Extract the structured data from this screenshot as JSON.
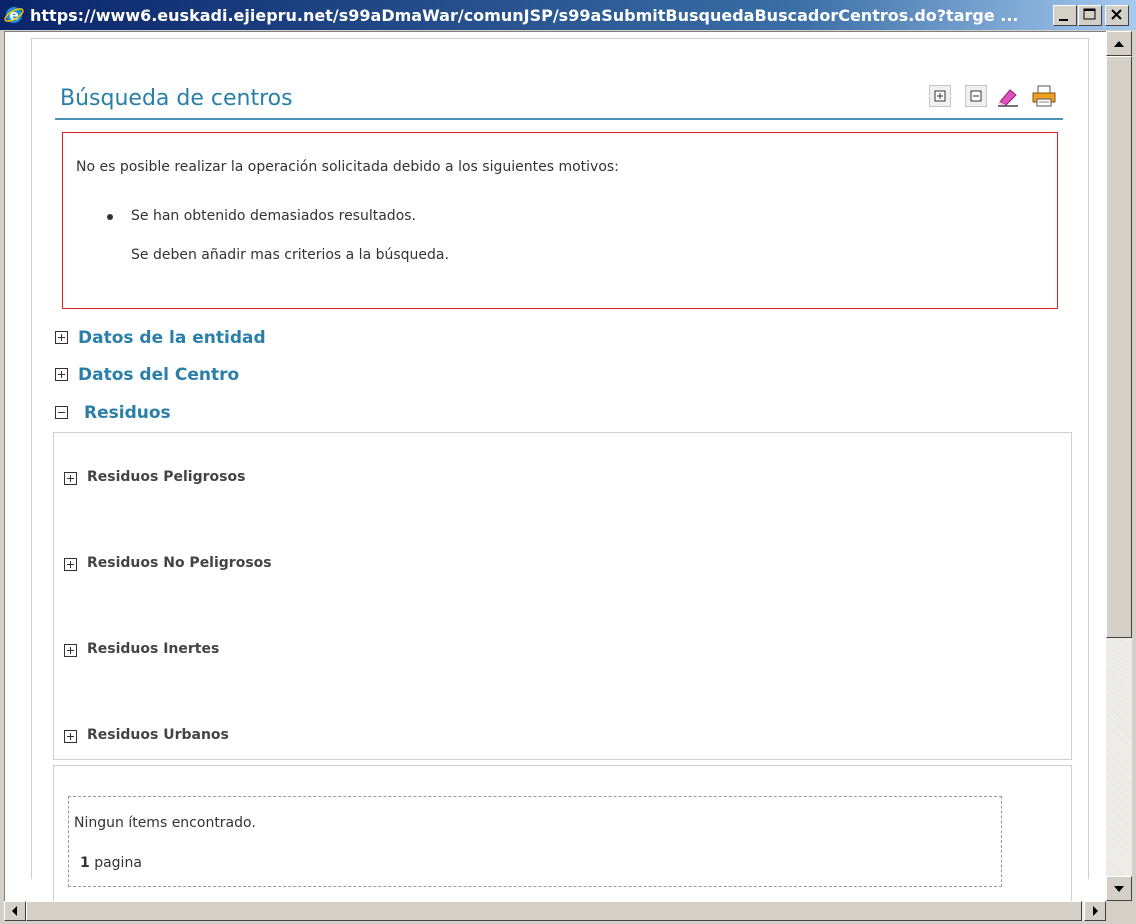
{
  "window": {
    "title": "https://www6.euskadi.ejiepru.net/s99aDmaWar/comunJSP/s99aSubmitBusquedaBuscadorCentros.do?targe ..."
  },
  "page": {
    "title": "Búsqueda de centros",
    "toolbar": [
      "expand-all-icon",
      "collapse-all-icon",
      "clear-form-icon",
      "print-icon"
    ]
  },
  "error": {
    "intro": "No es posible realizar la operación solicitada debido a los siguientes motivos:",
    "reason": "Se han obtenido demasiados resultados.",
    "hint": "Se deben añadir mas criterios a la búsqueda.",
    "border_color": "#e02020"
  },
  "sections": {
    "entidad": "Datos de la entidad",
    "centro": "Datos del Centro",
    "residuos": "Residuos"
  },
  "residuos": {
    "peligrosos": "Residuos Peligrosos",
    "no_peligrosos": "Residuos No Peligrosos",
    "inertes": "Residuos Inertes",
    "urbanos": "Residuos Urbanos"
  },
  "results": {
    "empty": "Ningun ítems encontrado.",
    "page_count": "1",
    "page_label": "pagina"
  },
  "colors": {
    "accent": "#2a7fa8",
    "titlebar": "#0a246a"
  }
}
